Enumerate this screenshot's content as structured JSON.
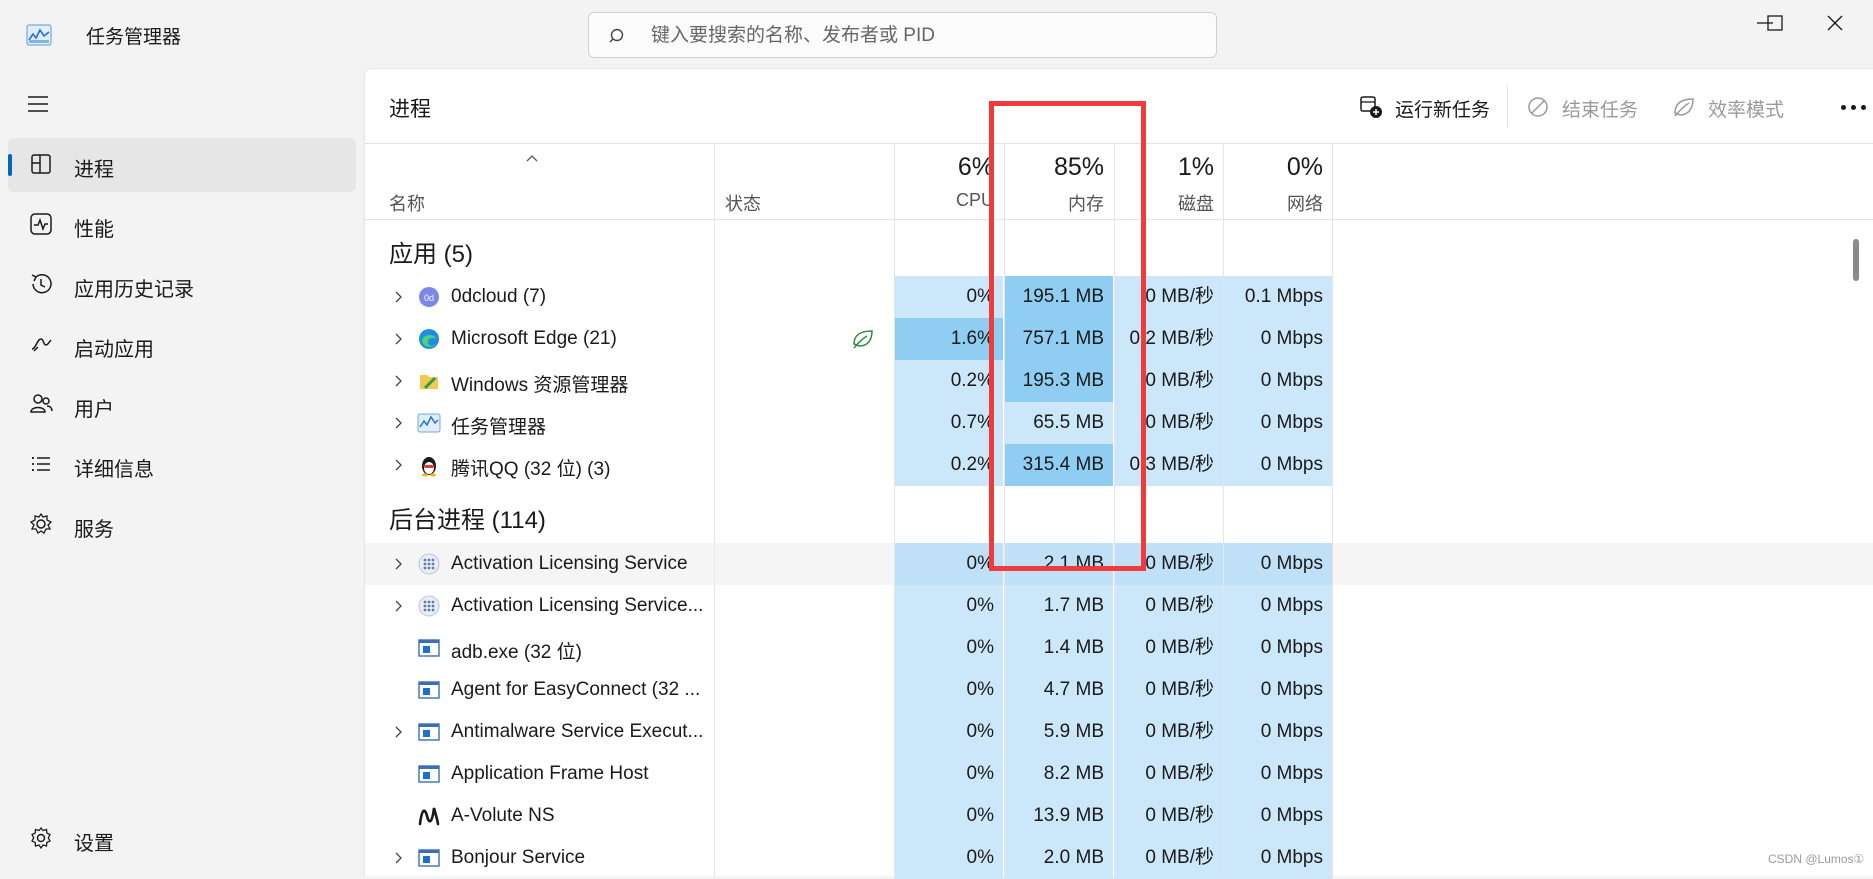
{
  "titlebar": {
    "app_title": "任务管理器",
    "search_placeholder": "键入要搜索的名称、发布者或 PID"
  },
  "sidebar": {
    "items": [
      {
        "label": "进程",
        "icon": "processes-icon"
      },
      {
        "label": "性能",
        "icon": "performance-icon"
      },
      {
        "label": "应用历史记录",
        "icon": "app-history-icon"
      },
      {
        "label": "启动应用",
        "icon": "startup-icon"
      },
      {
        "label": "用户",
        "icon": "users-icon"
      },
      {
        "label": "详细信息",
        "icon": "details-icon"
      },
      {
        "label": "服务",
        "icon": "services-icon"
      }
    ],
    "settings_label": "设置"
  },
  "main": {
    "title": "进程",
    "commands": {
      "run_new_task": "运行新任务",
      "end_task": "结束任务",
      "efficiency_mode": "效率模式"
    },
    "columns": {
      "name": "名称",
      "status": "状态",
      "cpu": {
        "pct": "6%",
        "label": "CPU"
      },
      "memory": {
        "pct": "85%",
        "label": "内存"
      },
      "disk": {
        "pct": "1%",
        "label": "磁盘"
      },
      "network": {
        "pct": "0%",
        "label": "网络"
      }
    },
    "groups": {
      "apps": {
        "title": "应用 (5)",
        "rows": [
          {
            "name": "0dcloud (7)",
            "icon": "0dcloud-icon",
            "cpu": "0%",
            "mem": "195.1 MB",
            "disk": "0 MB/秒",
            "net": "0.1 Mbps"
          },
          {
            "name": "Microsoft Edge (21)",
            "icon": "edge-icon",
            "status_icon": "efficiency-leaf-icon",
            "cpu": "1.6%",
            "mem": "757.1 MB",
            "disk": "0.2 MB/秒",
            "net": "0 Mbps"
          },
          {
            "name": "Windows 资源管理器",
            "icon": "explorer-icon",
            "cpu": "0.2%",
            "mem": "195.3 MB",
            "disk": "0 MB/秒",
            "net": "0 Mbps"
          },
          {
            "name": "任务管理器",
            "icon": "task-manager-icon",
            "cpu": "0.7%",
            "mem": "65.5 MB",
            "disk": "0 MB/秒",
            "net": "0 Mbps"
          },
          {
            "name": "腾讯QQ (32 位) (3)",
            "icon": "qq-icon",
            "cpu": "0.2%",
            "mem": "315.4 MB",
            "disk": "0.3 MB/秒",
            "net": "0 Mbps"
          }
        ]
      },
      "background": {
        "title": "后台进程 (114)",
        "rows": [
          {
            "name": "Activation Licensing Service",
            "icon": "service-dots-icon",
            "cpu": "0%",
            "mem": "2.1 MB",
            "disk": "0 MB/秒",
            "net": "0 Mbps"
          },
          {
            "name": "Activation Licensing Service...",
            "icon": "service-dots-icon",
            "cpu": "0%",
            "mem": "1.7 MB",
            "disk": "0 MB/秒",
            "net": "0 Mbps"
          },
          {
            "name": "adb.exe (32 位)",
            "icon": "window-app-icon",
            "cpu": "0%",
            "mem": "1.4 MB",
            "disk": "0 MB/秒",
            "net": "0 Mbps"
          },
          {
            "name": "Agent for EasyConnect (32 ...",
            "icon": "window-app-icon",
            "cpu": "0%",
            "mem": "4.7 MB",
            "disk": "0 MB/秒",
            "net": "0 Mbps"
          },
          {
            "name": "Antimalware Service Execut...",
            "icon": "window-app-icon",
            "cpu": "0%",
            "mem": "5.9 MB",
            "disk": "0 MB/秒",
            "net": "0 Mbps"
          },
          {
            "name": "Application Frame Host",
            "icon": "window-app-icon",
            "cpu": "0%",
            "mem": "8.2 MB",
            "disk": "0 MB/秒",
            "net": "0 Mbps"
          },
          {
            "name": "A-Volute NS",
            "icon": "a-volute-icon",
            "cpu": "0%",
            "mem": "13.9 MB",
            "disk": "0 MB/秒",
            "net": "0 Mbps"
          },
          {
            "name": "Bonjour Service",
            "icon": "window-app-icon",
            "cpu": "0%",
            "mem": "2.0 MB",
            "disk": "0 MB/秒",
            "net": "0 Mbps"
          }
        ]
      }
    }
  },
  "annotation": {
    "color": "#ef3b3b"
  },
  "watermark": "CSDN @Lumos①",
  "colors": {
    "accent": "#0067c0",
    "heat_light": "#cde7fa",
    "heat_strong": "#8fcdf2"
  }
}
